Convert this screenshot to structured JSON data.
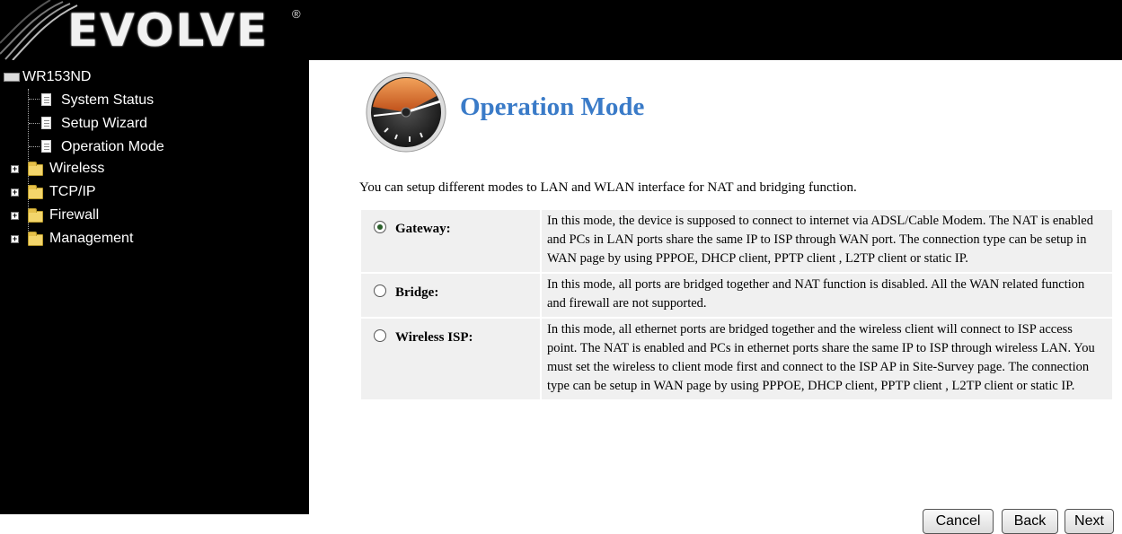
{
  "header": {
    "logo_text": "EVOLVE",
    "logo_mark": "®"
  },
  "sidebar": {
    "root": "WR153ND",
    "items": [
      {
        "label": "System Status",
        "type": "page"
      },
      {
        "label": "Setup Wizard",
        "type": "page"
      },
      {
        "label": "Operation Mode",
        "type": "page"
      },
      {
        "label": "Wireless",
        "type": "folder"
      },
      {
        "label": "TCP/IP",
        "type": "folder"
      },
      {
        "label": "Firewall",
        "type": "folder"
      },
      {
        "label": "Management",
        "type": "folder"
      }
    ]
  },
  "main": {
    "title": "Operation Mode",
    "description": "You can setup different modes to LAN and WLAN interface for NAT and bridging function.",
    "modes": [
      {
        "label": "Gateway:",
        "selected": true,
        "text": "In this mode, the device is supposed to connect to internet via ADSL/Cable Modem. The NAT is enabled and PCs in LAN ports share the same IP to ISP through WAN port. The connection type can be setup in WAN page by using PPPOE, DHCP client, PPTP client , L2TP client or static IP."
      },
      {
        "label": "Bridge:",
        "selected": false,
        "text": "In this mode, all ports are bridged together and NAT function is disabled. All the WAN related function and firewall are not supported."
      },
      {
        "label": "Wireless ISP:",
        "selected": false,
        "text": "In this mode, all ethernet ports are bridged together and the wireless client will connect to ISP access point. The NAT is enabled and PCs in ethernet ports share the same IP to ISP through wireless LAN. You must set the wireless to client mode first and connect to the ISP AP in Site-Survey page. The connection type can be setup in WAN page by using PPPOE, DHCP client, PPTP client , L2TP client or static IP."
      }
    ],
    "buttons": {
      "cancel": "Cancel",
      "back": "Back",
      "next": "Next"
    }
  },
  "colors": {
    "title_blue": "#3a7bc8",
    "header_bg": "#000000",
    "row_bg": "#f0f0f0"
  }
}
